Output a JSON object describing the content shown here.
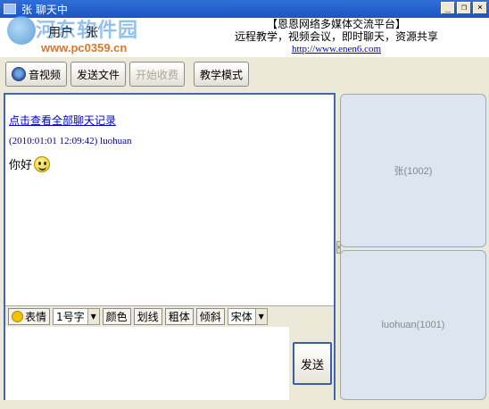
{
  "window": {
    "title": "张 聊天中",
    "app_icon": "app-icon",
    "controls": {
      "minimize": "_",
      "restore": "❐",
      "close": "×"
    }
  },
  "banner": {
    "user_label": "用户",
    "user_name": "张",
    "watermark_name": "河东软件园",
    "watermark_url": "www.pc0359.cn",
    "promo_line1": "【恩恩网络多媒体交流平台】",
    "promo_line2": "远程教学，视频会议，即时聊天，资源共享",
    "promo_link": "http://www.enen6.com"
  },
  "toolbar": {
    "video_label": "音视频",
    "send_file_label": "发送文件",
    "start_charge_label": "开始收费",
    "teach_mode_label": "教学模式"
  },
  "chat": {
    "history_link": "点击查看全部聊天记录",
    "messages": [
      {
        "header": "(2010:01:01 12:09:42)  luohuan",
        "text": "你好"
      }
    ]
  },
  "format_bar": {
    "emoji_label": "表情",
    "font_size": "1号字",
    "color_label": "颜色",
    "underline_label": "划线",
    "bold_label": "粗体",
    "italic_label": "倾斜",
    "font_face": "宋体"
  },
  "input": {
    "value": "",
    "send_label": "发送"
  },
  "splitter_glyph": "›",
  "video_panels": [
    {
      "label": "张(1002)"
    },
    {
      "label": "luohuan(1001)"
    }
  ],
  "colors": {
    "title_bar": "#1c54c4",
    "frame_border": "#4267b2",
    "link": "#0000cc",
    "panel_bg": "#dde6ef"
  }
}
